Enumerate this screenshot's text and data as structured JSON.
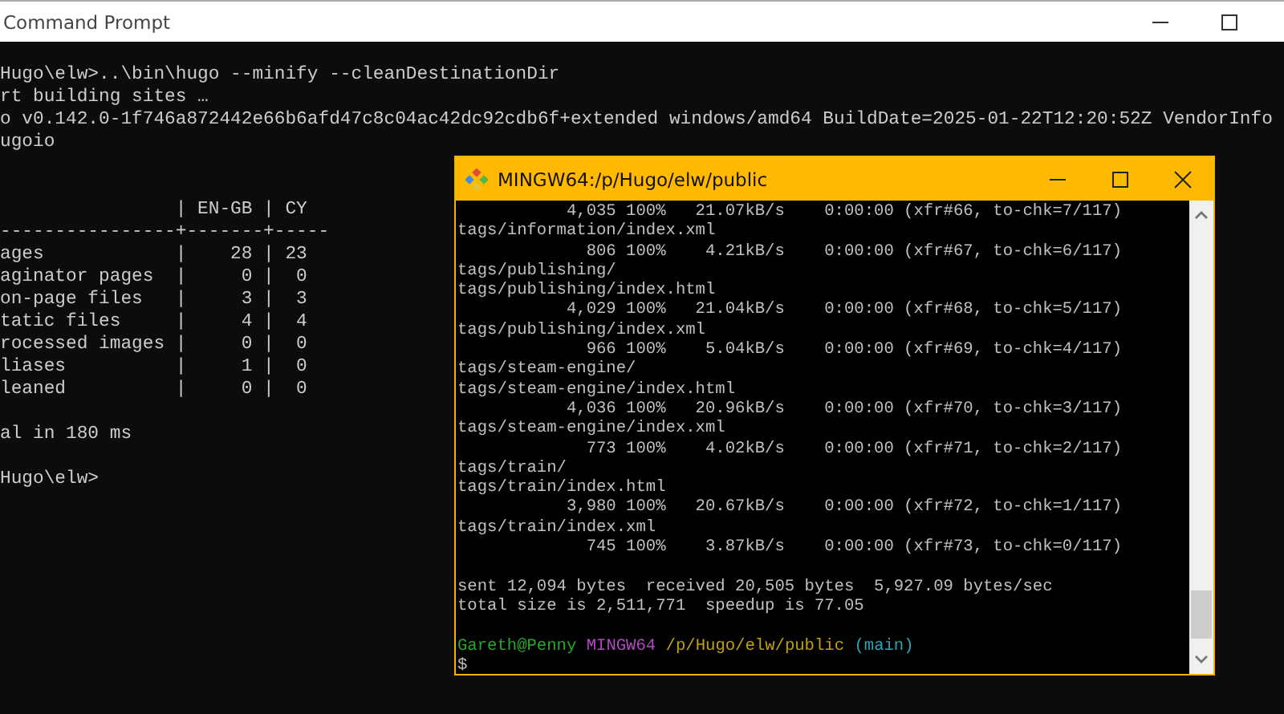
{
  "cmd_window": {
    "title": "Command Prompt",
    "output_lines": [
      "Hugo\\elw>..\\bin\\hugo --minify --cleanDestinationDir",
      "rt building sites …",
      "o v0.142.0-1f746a872442e66b6afd47c8c04ac42dc92cdb6f+extended windows/amd64 BuildDate=2025-01-22T12:20:52Z VendorInfo",
      "ugoio"
    ],
    "table_lines": [
      "                | EN-GB | CY",
      "----------------+-------+-----",
      "ages            |    28 | 23",
      "aginator pages  |     0 |  0",
      "on-page files   |     3 |  3",
      "tatic files     |     4 |  4",
      "rocessed images |     0 |  0",
      "liases          |     1 |  0",
      "leaned          |     0 |  0"
    ],
    "summary": "al in 180 ms",
    "prompt": "Hugo\\elw>"
  },
  "mingw_window": {
    "title": "MINGW64:/p/Hugo/elw/public",
    "blocks": [
      [
        "           4,035 100%   21.07kB/s    0:00:00 (xfr#66, to-chk=7/117)",
        "tags/information/index.xml",
        "             806 100%    4.21kB/s    0:00:00 (xfr#67, to-chk=6/117)",
        "tags/publishing/",
        "tags/publishing/index.html",
        "           4,029 100%   21.04kB/s    0:00:00 (xfr#68, to-chk=5/117)",
        "tags/publishing/index.xml",
        "             966 100%    5.04kB/s    0:00:00 (xfr#69, to-chk=4/117)",
        "tags/steam-engine/",
        "tags/steam-engine/index.html",
        "           4,036 100%   20.96kB/s    0:00:00 (xfr#70, to-chk=3/117)",
        "tags/steam-engine/index.xml",
        "             773 100%    4.02kB/s    0:00:00 (xfr#71, to-chk=2/117)",
        "tags/train/",
        "tags/train/index.html",
        "           3,980 100%   20.67kB/s    0:00:00 (xfr#72, to-chk=1/117)",
        "tags/train/index.xml",
        "             745 100%    3.87kB/s    0:00:00 (xfr#73, to-chk=0/117)"
      ],
      [
        "sent 12,094 bytes  received 20,505 bytes  5,927.09 bytes/sec",
        "total size is 2,511,771  speedup is 77.05"
      ]
    ],
    "prompt": [
      {
        "text": "Gareth@Penny",
        "color": "#28a828"
      },
      {
        "text": "MINGW64",
        "color": "#b248c4"
      },
      {
        "text": "/p/Hugo/elw/public",
        "color": "#c0a010"
      },
      {
        "text": "(main)",
        "color": "#2aa5b5"
      }
    ],
    "input_line": "$"
  }
}
